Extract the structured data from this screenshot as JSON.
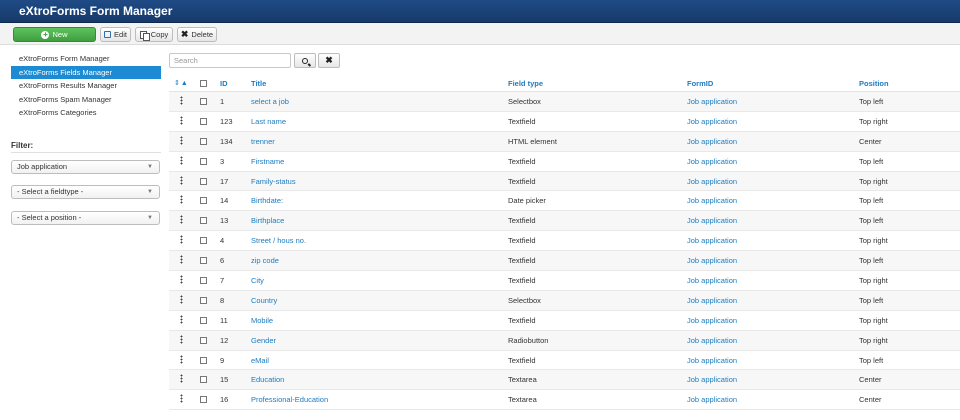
{
  "app": {
    "title": "eXtroForms Form Manager"
  },
  "toolbar": {
    "new_label": "New",
    "edit_label": "Edit",
    "copy_label": "Copy",
    "delete_label": "Delete",
    "new_color": "#46a546"
  },
  "sidebar": {
    "items": [
      {
        "label": "eXtroForms Form Manager",
        "active": false
      },
      {
        "label": "eXtroForms Fields Manager",
        "active": true
      },
      {
        "label": "eXtroForms Results Manager",
        "active": false
      },
      {
        "label": "eXtroForms Spam Manager",
        "active": false
      },
      {
        "label": "eXtroForms Categories",
        "active": false
      }
    ],
    "active_color": "#1c8bd4"
  },
  "filter": {
    "label": "Filter:",
    "form_value": "Job application",
    "fieldtype_value": "- Select a fieldtype -",
    "position_value": "- Select a position -"
  },
  "search": {
    "placeholder": "Search"
  },
  "table": {
    "headers": {
      "id": "ID",
      "title": "Title",
      "field_type": "Field type",
      "formid": "FormID",
      "position": "Position"
    },
    "rows": [
      {
        "id": "1",
        "title": "select a job",
        "type": "Selectbox",
        "form": "Job application",
        "position": "Top left"
      },
      {
        "id": "123",
        "title": "Last name",
        "type": "Textfield",
        "form": "Job application",
        "position": "Top right"
      },
      {
        "id": "134",
        "title": "trenner",
        "type": "HTML element",
        "form": "Job application",
        "position": "Center"
      },
      {
        "id": "3",
        "title": "Firstname",
        "type": "Textfield",
        "form": "Job application",
        "position": "Top left"
      },
      {
        "id": "17",
        "title": "Family-status",
        "type": "Textfield",
        "form": "Job application",
        "position": "Top right"
      },
      {
        "id": "14",
        "title": "Birthdate:",
        "type": "Date picker",
        "form": "Job application",
        "position": "Top left"
      },
      {
        "id": "13",
        "title": "Birthplace",
        "type": "Textfield",
        "form": "Job application",
        "position": "Top left"
      },
      {
        "id": "4",
        "title": "Street / hous no.",
        "type": "Textfield",
        "form": "Job application",
        "position": "Top right"
      },
      {
        "id": "6",
        "title": "zip code",
        "type": "Textfield",
        "form": "Job application",
        "position": "Top left"
      },
      {
        "id": "7",
        "title": "City",
        "type": "Textfield",
        "form": "Job application",
        "position": "Top right"
      },
      {
        "id": "8",
        "title": "Country",
        "type": "Selectbox",
        "form": "Job application",
        "position": "Top left"
      },
      {
        "id": "11",
        "title": "Mobile",
        "type": "Textfield",
        "form": "Job application",
        "position": "Top right"
      },
      {
        "id": "12",
        "title": "Gender",
        "type": "Radiobutton",
        "form": "Job application",
        "position": "Top right"
      },
      {
        "id": "9",
        "title": "eMail",
        "type": "Textfield",
        "form": "Job application",
        "position": "Top left"
      },
      {
        "id": "15",
        "title": "Education",
        "type": "Textarea",
        "form": "Job application",
        "position": "Center"
      },
      {
        "id": "16",
        "title": "Professional-Education",
        "type": "Textarea",
        "form": "Job application",
        "position": "Center"
      }
    ]
  }
}
